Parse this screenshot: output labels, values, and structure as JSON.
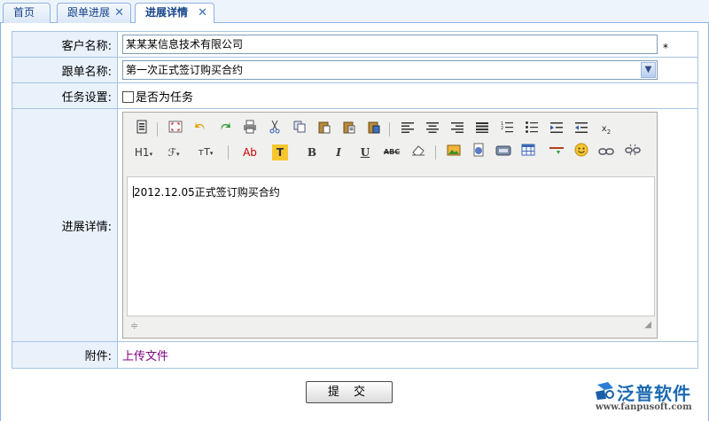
{
  "tabs": [
    {
      "label": "首页"
    },
    {
      "label": "跟单进展",
      "close": "✕"
    },
    {
      "label": "进展详情",
      "close": "✕"
    }
  ],
  "form": {
    "customer": {
      "label": "客户名称:",
      "value": "某某某信息技术有限公司",
      "required_mark": "*"
    },
    "order": {
      "label": "跟单名称:",
      "value": "第一次正式签订购买合约"
    },
    "task": {
      "label": "任务设置:",
      "checkbox_label": "是否为任务",
      "checked": false
    },
    "detail": {
      "label": "进展详情:",
      "content": "2012.12.05正式签订购买合约"
    },
    "attachment": {
      "label": "附件:",
      "link": "上传文件"
    }
  },
  "editor_toolbar": {
    "row1": [
      "source-icon",
      "fullscreen-icon",
      "undo-icon",
      "redo-icon",
      "print-icon",
      "cut-icon",
      "copy-icon",
      "paste-icon",
      "paste-text-icon",
      "paste-word-icon",
      "align-left-icon",
      "align-center-icon",
      "align-right-icon",
      "justify-icon",
      "ordered-list-icon",
      "unordered-list-icon",
      "indent-icon",
      "outdent-icon",
      "subscript-icon"
    ],
    "row2_labels": {
      "heading": "H1",
      "font": "ℱ",
      "size": "тT",
      "color": "Ab",
      "bg": "T",
      "bold": "B",
      "italic": "I",
      "underline": "U",
      "strike": "ABC"
    }
  },
  "submit_label": "提 交",
  "logo": {
    "name": "泛普软件",
    "url": "www.fanpusoft.com"
  },
  "colors": {
    "accent": "#15428b",
    "border": "#8db2e3",
    "label_bg": "#e9f2fb",
    "link": "#800080"
  }
}
